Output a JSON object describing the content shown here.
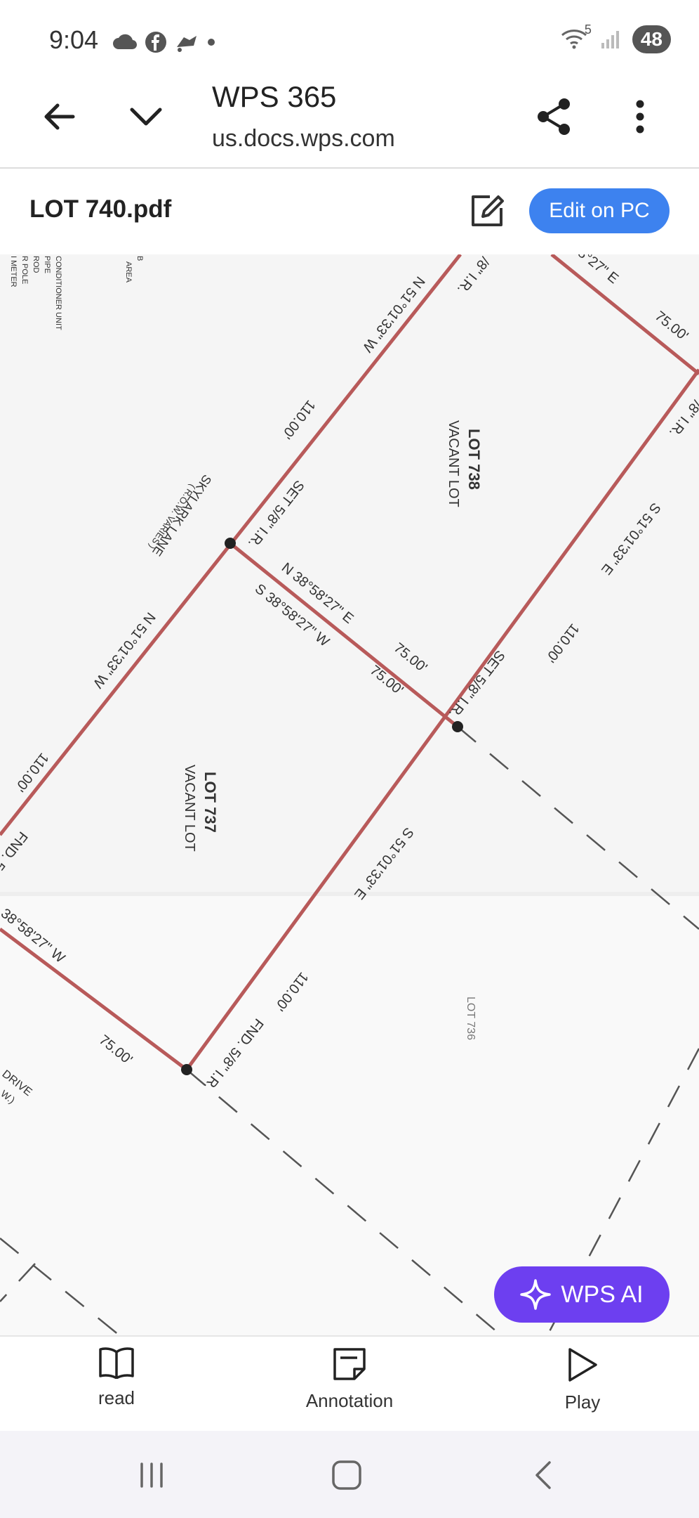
{
  "status_bar": {
    "time": "9:04",
    "wifi_badge": "5",
    "battery": "48",
    "icons": [
      "cloud-icon",
      "facebook-icon",
      "cast-icon",
      "dot-icon",
      "wifi-icon",
      "signal-icon"
    ]
  },
  "browser": {
    "title": "WPS 365",
    "url": "us.docs.wps.com",
    "icons": [
      "back-arrow-icon",
      "chevron-down-icon",
      "share-icon",
      "more-vert-icon"
    ]
  },
  "document": {
    "file_name": "LOT 740.pdf",
    "edit_on_pc_label": "Edit on PC",
    "edit_icon": "edit-pencil-icon"
  },
  "survey": {
    "legend_items": [
      "CONDITIONER UNIT",
      "PIPE",
      "ROD",
      "R POLE",
      "I METER"
    ],
    "legend_top_item": "B",
    "legend_area": "AREA",
    "lot_738": "LOT 738",
    "lot_738_sub": "VACANT LOT",
    "lot_737": "LOT 737",
    "lot_737_sub": "VACANT LOT",
    "lot_736": "LOT 736",
    "street": "SKYLARK LANE",
    "street_sub": "( R.O.W. VARIES )",
    "drive": "DRIVE",
    "drive_sub": "W.)",
    "bearing_n51": "N 51°01'33\" W",
    "bearing_s51": "S 51°01'33\" E",
    "bearing_n38": "N 38°58'27\" E",
    "bearing_s38": "S 38°58'27\" W",
    "bearing_partial_top": "8°27\" E",
    "bearing_partial_left": "38°58'27\" W",
    "dist_110": "110.00'",
    "dist_75": "75.00'",
    "set_iron": "SET 5/8\" I.R.",
    "fnd_iron": "FND. 5/8\" I.R.",
    "fnd_partial": "FND. 5/",
    "ir_partial": "/8\" I.R.",
    "ir_partial_top": "/8\" I.R."
  },
  "ai_button": {
    "label": "WPS AI",
    "icon": "sparkle-icon"
  },
  "toolbar": {
    "items": [
      {
        "label": "read",
        "icon": "book-icon"
      },
      {
        "label": "Annotation",
        "icon": "note-icon"
      },
      {
        "label": "Play",
        "icon": "play-icon"
      }
    ]
  },
  "nav_bar": {
    "icons": [
      "recent-apps-icon",
      "home-icon",
      "back-icon"
    ]
  },
  "colors": {
    "boundary_line": "#b85a5a",
    "edit_button": "#3d82ef",
    "ai_button": "#6d3ff0"
  }
}
